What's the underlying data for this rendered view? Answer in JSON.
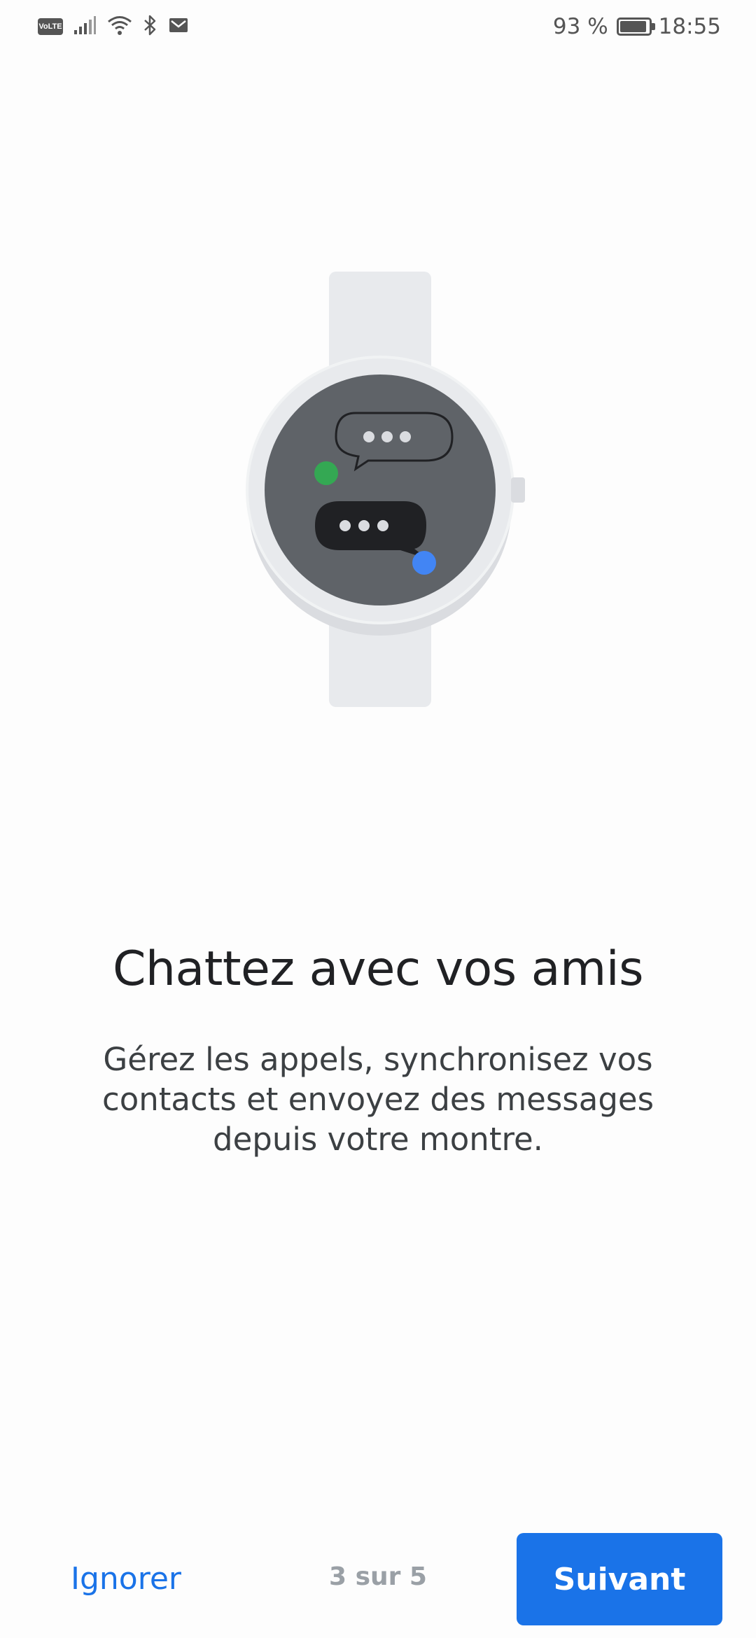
{
  "status_bar": {
    "battery_text": "93 %",
    "time": "18:55",
    "volte_label": "VoLTE",
    "icons": [
      "volte-icon",
      "signal-icon",
      "wifi-icon",
      "bluetooth-icon",
      "mail-icon",
      "battery-icon"
    ],
    "battery_level": 0.93
  },
  "illustration": {
    "name": "watch-chat-illustration",
    "colors": {
      "band": "#e8eaed",
      "case": "#e8eaed",
      "dial": "#5f6368",
      "bubble_dark": "#202124",
      "dot_light": "#dadce0",
      "green_dot": "#34a853",
      "blue_dot": "#4285f4"
    }
  },
  "content": {
    "headline": "Chattez avec vos amis",
    "description": "Gérez les appels, synchronisez vos contacts et envoyez des messages depuis votre montre."
  },
  "footer": {
    "skip_label": "Ignorer",
    "step_label": "3 sur 5",
    "next_label": "Suivant",
    "current_step": 3,
    "total_steps": 5
  },
  "colors": {
    "accent": "#1a73e8",
    "text_primary": "#202124",
    "text_muted": "#9aa0a6"
  }
}
